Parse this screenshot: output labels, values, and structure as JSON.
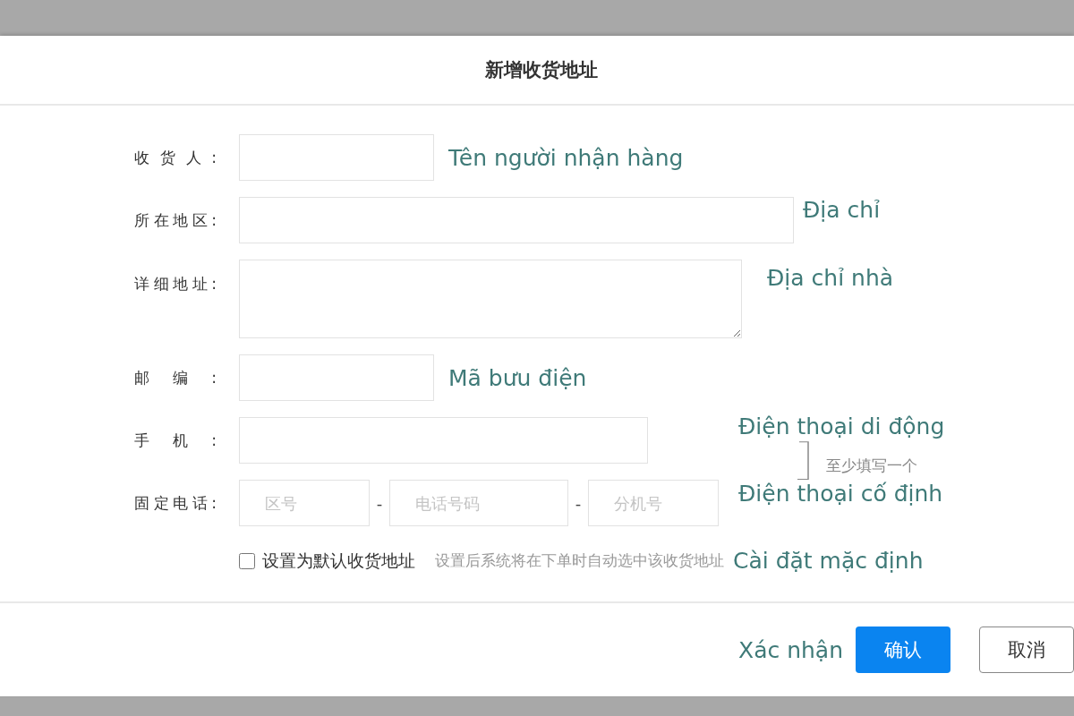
{
  "dialog": {
    "title": "新增收货地址"
  },
  "fields": [
    {
      "kind": "short",
      "label": "收货人:",
      "annotation": "Tên người nhận hàng"
    },
    {
      "kind": "wide",
      "label": "所在地区:",
      "annotation": "Địa chỉ"
    },
    {
      "kind": "textarea",
      "label": "详细地址:",
      "annotation": "Địa chỉ nhà"
    },
    {
      "kind": "short",
      "label": "邮编:",
      "annotation": "Mã bưu điện"
    }
  ],
  "phone": {
    "mobile": {
      "label": "手机:",
      "annotation": "Điện thoại di động"
    },
    "landline": {
      "label": "固定电话:",
      "placeholders": [
        "区号",
        "电话号码",
        "分机号"
      ],
      "separators": [
        "-",
        "-"
      ],
      "annotation": "Điện thoại cố định"
    },
    "note": "至少填写一个"
  },
  "default_option": {
    "label": "设置为默认收货地址",
    "checked": false,
    "hint": "设置后系统将在下单时自动选中该收货地址",
    "annotation": "Cài đặt mặc định"
  },
  "footer": {
    "annotation": "Xác nhận",
    "buttons": [
      {
        "label": "确认",
        "kind": "primary"
      },
      {
        "label": "取消",
        "kind": "secondary"
      }
    ]
  }
}
